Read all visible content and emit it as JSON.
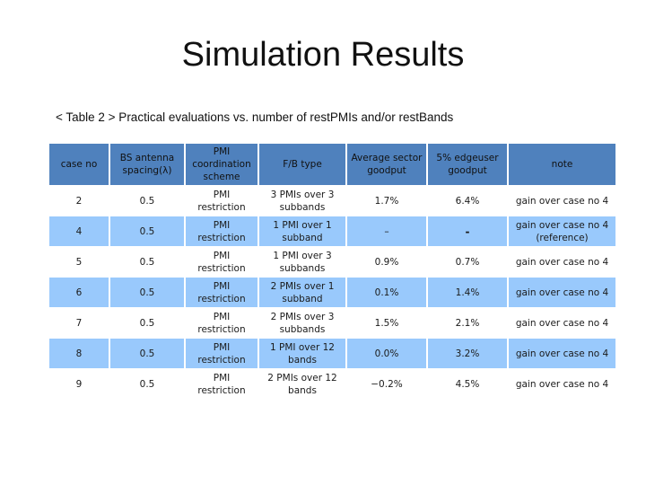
{
  "slide": {
    "title": "Simulation Results",
    "caption": "< Table 2 > Practical evaluations vs. number of restPMIs and/or restBands"
  },
  "table": {
    "header_color": "#4f81bd",
    "alt_row_color": "#99c9fc",
    "columns": [
      "case no",
      "BS antenna spacing(λ)",
      "PMI coordination scheme",
      "F/B type",
      "Average sector goodput",
      "5% edgeuser goodput",
      "note"
    ],
    "rows": [
      {
        "case_no": "2",
        "spacing": "0.5",
        "scheme": "PMI restriction",
        "fb_type": "3 PMIs over 3 subbands",
        "avg_goodput": "1.7%",
        "edge_goodput": "6.4%",
        "note": "gain over case no 4"
      },
      {
        "case_no": "4",
        "spacing": "0.5",
        "scheme": "PMI restriction",
        "fb_type": "1 PMI over 1 subband",
        "avg_goodput": "–",
        "edge_goodput": "-",
        "note": "gain over case no 4 (reference)"
      },
      {
        "case_no": "5",
        "spacing": "0.5",
        "scheme": "PMI restriction",
        "fb_type": "1 PMI over 3 subbands",
        "avg_goodput": "0.9%",
        "edge_goodput": "0.7%",
        "note": "gain over case no 4"
      },
      {
        "case_no": "6",
        "spacing": "0.5",
        "scheme": "PMI restriction",
        "fb_type": "2 PMIs over 1 subband",
        "avg_goodput": "0.1%",
        "edge_goodput": "1.4%",
        "note": "gain over case no 4"
      },
      {
        "case_no": "7",
        "spacing": "0.5",
        "scheme": "PMI restriction",
        "fb_type": "2 PMIs over 3 subbands",
        "avg_goodput": "1.5%",
        "edge_goodput": "2.1%",
        "note": "gain over case no 4"
      },
      {
        "case_no": "8",
        "spacing": "0.5",
        "scheme": "PMI restriction",
        "fb_type": "1 PMI over 12 bands",
        "avg_goodput": "0.0%",
        "edge_goodput": "3.2%",
        "note": "gain over case no 4"
      },
      {
        "case_no": "9",
        "spacing": "0.5",
        "scheme": "PMI restriction",
        "fb_type": "2 PMIs over 12 bands",
        "avg_goodput": "−0.2%",
        "edge_goodput": "4.5%",
        "note": "gain over case no 4"
      }
    ]
  }
}
